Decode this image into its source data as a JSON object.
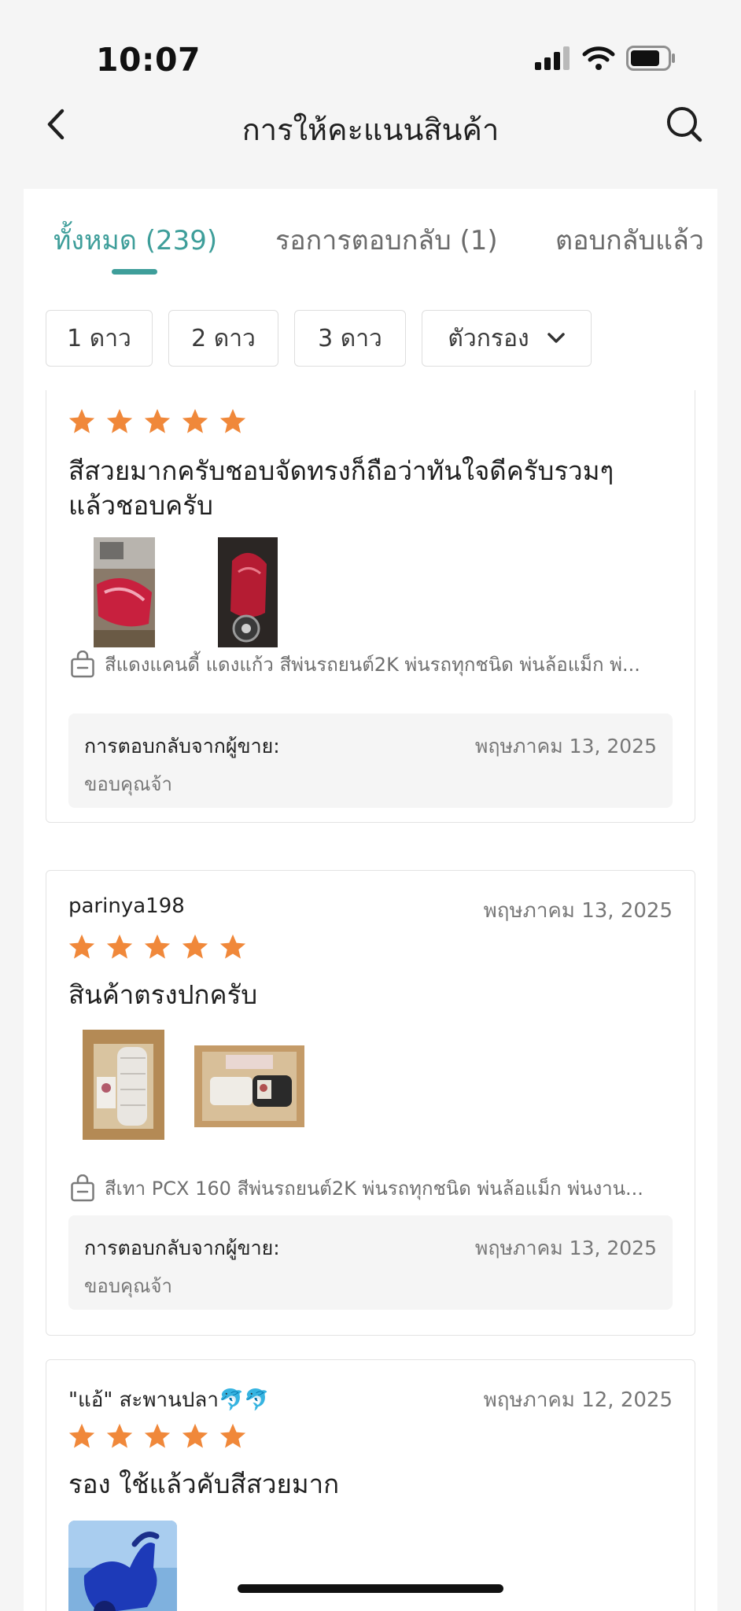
{
  "status_bar": {
    "time": "10:07"
  },
  "header": {
    "title": "การให้คะแนนสินค้า"
  },
  "tabs": [
    {
      "label": "ทั้งหมด (239)",
      "active": true
    },
    {
      "label": "รอการตอบกลับ (1)",
      "active": false
    },
    {
      "label": "ตอบกลับแล้ว",
      "active": false
    }
  ],
  "filters": {
    "one_star": "1 ดาว",
    "two_star": "2 ดาว",
    "three_star": "3 ดาว",
    "filter_dropdown": "ตัวกรอง"
  },
  "colors": {
    "accent": "#3e9e9a",
    "star": "#f0883a",
    "reply_bg": "#f5f5f5"
  },
  "reviews": [
    {
      "user": "",
      "date": "",
      "rating": 5,
      "text": "สีสวยมากครับชอบจัดทรงก็ถือว่าทันใจดีครับรวมๆ แล้วชอบครับ",
      "images": [
        "red-scooter-parts-photo",
        "red-scooter-photo"
      ],
      "variant": "สีแดงแคนดี้ แดงแก้ว สีพ่นรถยนต์2K พ่นรถทุกชนิด พ่นล้อแม็ก พ่...",
      "seller_reply": {
        "label": "การตอบกลับจากผู้ขาย:",
        "date": "พฤษภาคม 13, 2025",
        "text": "ขอบคุณจ้า"
      }
    },
    {
      "user": "parinya198",
      "date": "พฤษภาคม 13, 2025",
      "rating": 5,
      "text": "สินค้าตรงปกครับ",
      "images": [
        "package-box-photo",
        "spray-can-box-photo"
      ],
      "variant": "สีเทา PCX 160 สีพ่นรถยนต์2K พ่นรถทุกชนิด พ่นล้อแม็ก พ่นงาน...",
      "seller_reply": {
        "label": "การตอบกลับจากผู้ขาย:",
        "date": "พฤษภาคม 13, 2025",
        "text": "ขอบคุณจ้า"
      }
    },
    {
      "user": "\"แอ้\" สะพานปลา🐬🐬",
      "date": "พฤษภาคม 12, 2025",
      "rating": 5,
      "text": "รอง ใช้แล้วคับสีสวยมาก",
      "images": [
        "blue-scooter-photo"
      ]
    }
  ]
}
